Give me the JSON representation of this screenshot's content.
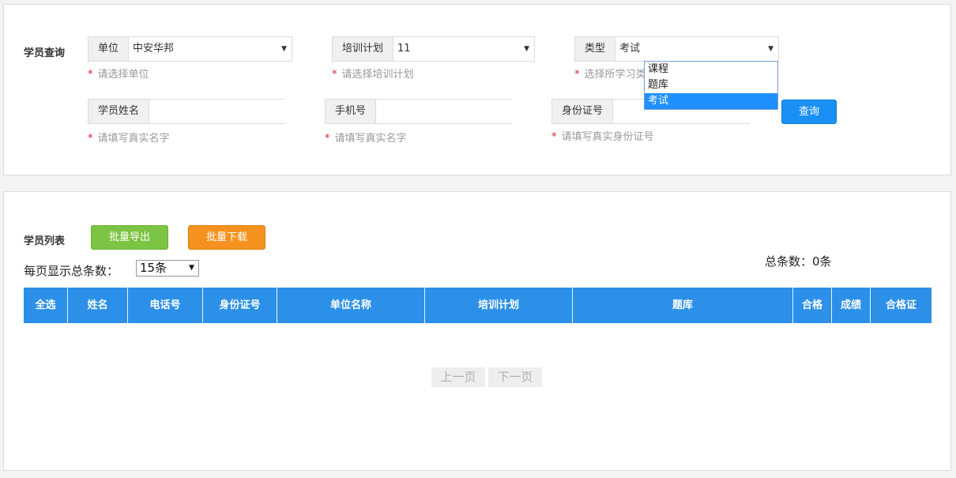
{
  "query": {
    "section_title": "学员查询",
    "unit": {
      "label": "单位",
      "value": "中安华邦",
      "hint": "请选择单位"
    },
    "plan": {
      "label": "培训计划",
      "value": "11",
      "hint": "请选择培训计划"
    },
    "type": {
      "label": "类型",
      "value": "考试",
      "hint": "选择所学习类"
    },
    "type_options": [
      "课程",
      "题库",
      "考试"
    ],
    "name": {
      "label": "学员姓名",
      "value": "",
      "hint": "请填写真实名字"
    },
    "phone": {
      "label": "手机号",
      "value": "",
      "hint": "请填写真实名字"
    },
    "idcard": {
      "label": "身份证号",
      "value": "",
      "hint": "请填写真实身份证号"
    },
    "required_mark": "*",
    "search_button": "查询"
  },
  "list": {
    "section_title": "学员列表",
    "export_button": "批量导出",
    "download_button": "批量下载",
    "per_page_label": "每页显示总条数：",
    "per_page_value": "15条",
    "total_label": "总条数：0条",
    "columns": [
      "全选",
      "姓名",
      "电话号",
      "身份证号",
      "单位名称",
      "培训计划",
      "题库",
      "合格",
      "成绩",
      "合格证"
    ],
    "prev_page": "上一页",
    "next_page": "下一页"
  },
  "colors": {
    "primary": "#1a90f5",
    "header": "#2c90e8",
    "export": "#7cc443",
    "download": "#f5921f",
    "required": "#e02020"
  }
}
